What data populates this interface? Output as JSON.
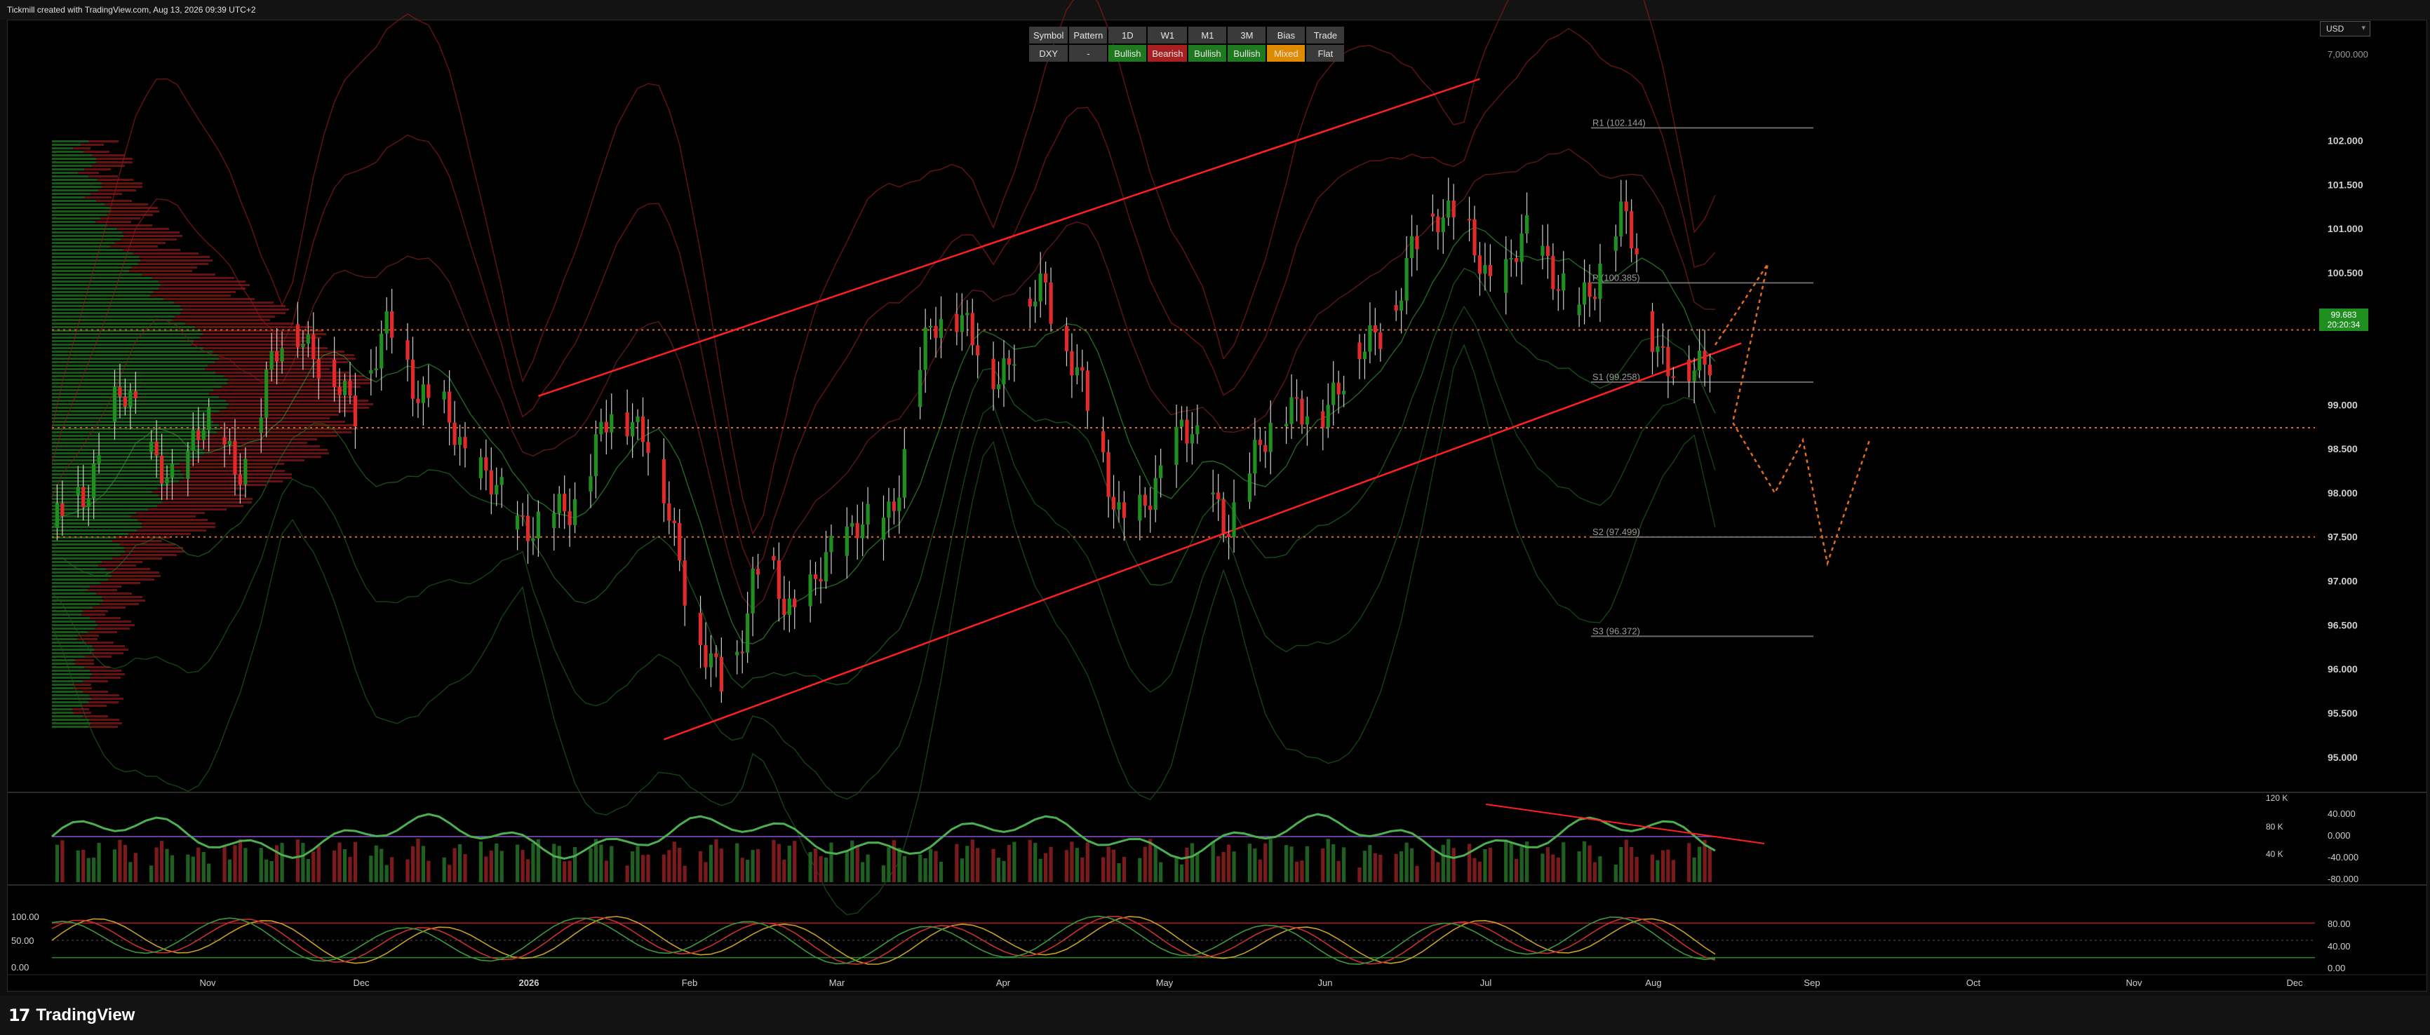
{
  "header": {
    "credit": "Tickmill created with TradingView.com, Aug 13, 2026 09:39 UTC+2"
  },
  "currency_selector": {
    "value": "USD"
  },
  "bias_table": {
    "headers": [
      "Symbol",
      "Pattern",
      "1D",
      "W1",
      "M1",
      "3M",
      "Bias",
      "Trade"
    ],
    "values": [
      "DXY",
      "-",
      "Bullish",
      "Bearish",
      "Bullish",
      "Bullish",
      "Mixed",
      "Flat"
    ],
    "value_colors": [
      "#3a3a3a",
      "#3a3a3a",
      "#1f7a1f",
      "#a81f1f",
      "#1f7a1f",
      "#1f7a1f",
      "#e08a00",
      "#3a3a3a"
    ]
  },
  "price_badge": {
    "price": "99.683",
    "countdown": "20:20:34"
  },
  "footer": {
    "brand": "TradingView",
    "brand_mark": "17"
  },
  "colors": {
    "bull": "#1f8f1f",
    "bear": "#e22a2a",
    "level_line": "#6a6a6a",
    "forecast": "#e06a20",
    "channel": "#ff2020"
  },
  "chart_data": [
    {
      "type": "candlestick",
      "symbol": "DXY",
      "ylim": [
        94.6,
        102.8
      ],
      "y_ticks": [
        "102.000",
        "101.500",
        "101.000",
        "100.500",
        "100.000",
        "99.000",
        "98.500",
        "98.000",
        "97.500",
        "97.000",
        "96.500",
        "96.000",
        "95.500",
        "95.000"
      ],
      "y_top_label": "7,000.000",
      "current_price": 99.683,
      "x_ticks": [
        "Nov",
        "Dec",
        "2026",
        "Feb",
        "Mar",
        "Apr",
        "May",
        "Jun",
        "Jul",
        "Aug",
        "Sep",
        "Oct",
        "Nov",
        "Dec"
      ],
      "pivot_levels": [
        {
          "label": "R1 (102.144)",
          "value": 102.144
        },
        {
          "label": "P (100.385)",
          "value": 100.385
        },
        {
          "label": "S1 (99.258)",
          "value": 99.258
        },
        {
          "label": "S2 (97.499)",
          "value": 97.499
        },
        {
          "label": "S3 (96.372)",
          "value": 96.372
        }
      ],
      "dotted_levels": [
        99.85,
        98.74,
        97.5
      ],
      "channel": {
        "lower": [
          [
            "Jan 26",
            95.2
          ],
          [
            "Aug 20",
            99.7
          ]
        ],
        "upper": [
          [
            "Jan 2",
            99.1
          ],
          [
            "Jul 1",
            102.7
          ]
        ]
      },
      "ohlc_series_close": [
        97.6,
        97.7,
        98.0,
        98.4,
        98.9,
        99.1,
        98.8,
        98.3,
        98.0,
        98.5,
        99.0,
        98.7,
        98.1,
        98.6,
        99.3,
        99.6,
        99.9,
        99.7,
        99.3,
        99.1,
        99.0,
        99.5,
        99.8,
        99.6,
        99.2,
        99.0,
        98.8,
        98.5,
        98.3,
        98.0,
        97.8,
        97.7,
        97.6,
        97.7,
        97.9,
        98.2,
        98.6,
        99.0,
        98.9,
        98.6,
        98.0,
        97.4,
        96.6,
        96.0,
        95.8,
        96.3,
        97.0,
        97.1,
        96.8,
        96.7,
        96.9,
        97.3,
        97.6,
        97.7,
        97.5,
        97.8,
        98.6,
        99.5,
        99.9,
        100.2,
        99.9,
        99.4,
        99.3,
        99.7,
        100.1,
        100.3,
        99.9,
        99.5,
        98.8,
        98.3,
        97.8,
        97.6,
        97.9,
        98.4,
        98.8,
        98.5,
        98.0,
        97.7,
        97.9,
        98.4,
        98.9,
        99.0,
        98.8,
        98.9,
        99.2,
        99.4,
        99.6,
        99.9,
        100.1,
        100.6,
        101.0,
        101.3,
        101.1,
        100.8,
        100.5,
        100.4,
        100.7,
        101.0,
        100.7,
        100.3,
        100.0,
        100.4,
        100.9,
        101.1,
        100.6,
        99.8,
        99.4,
        99.3,
        99.5,
        99.7
      ],
      "range_days": {
        "start": "Oct 1, 2025",
        "last_bar": "Aug 13, 2026"
      }
    },
    {
      "type": "histogram+line",
      "name": "volume_oscillator",
      "y_ticks_left": [
        "120 K",
        "80 K",
        "40 K"
      ],
      "y_ticks_right": [
        "40.000",
        "0.000",
        "-40.000",
        "-80.000"
      ]
    },
    {
      "type": "line",
      "name": "oscillator",
      "y_ticks_left": [
        "100.00",
        "50.00",
        "0.00"
      ],
      "y_ticks_right": [
        "80.00",
        "40.00",
        "0.00"
      ]
    }
  ]
}
